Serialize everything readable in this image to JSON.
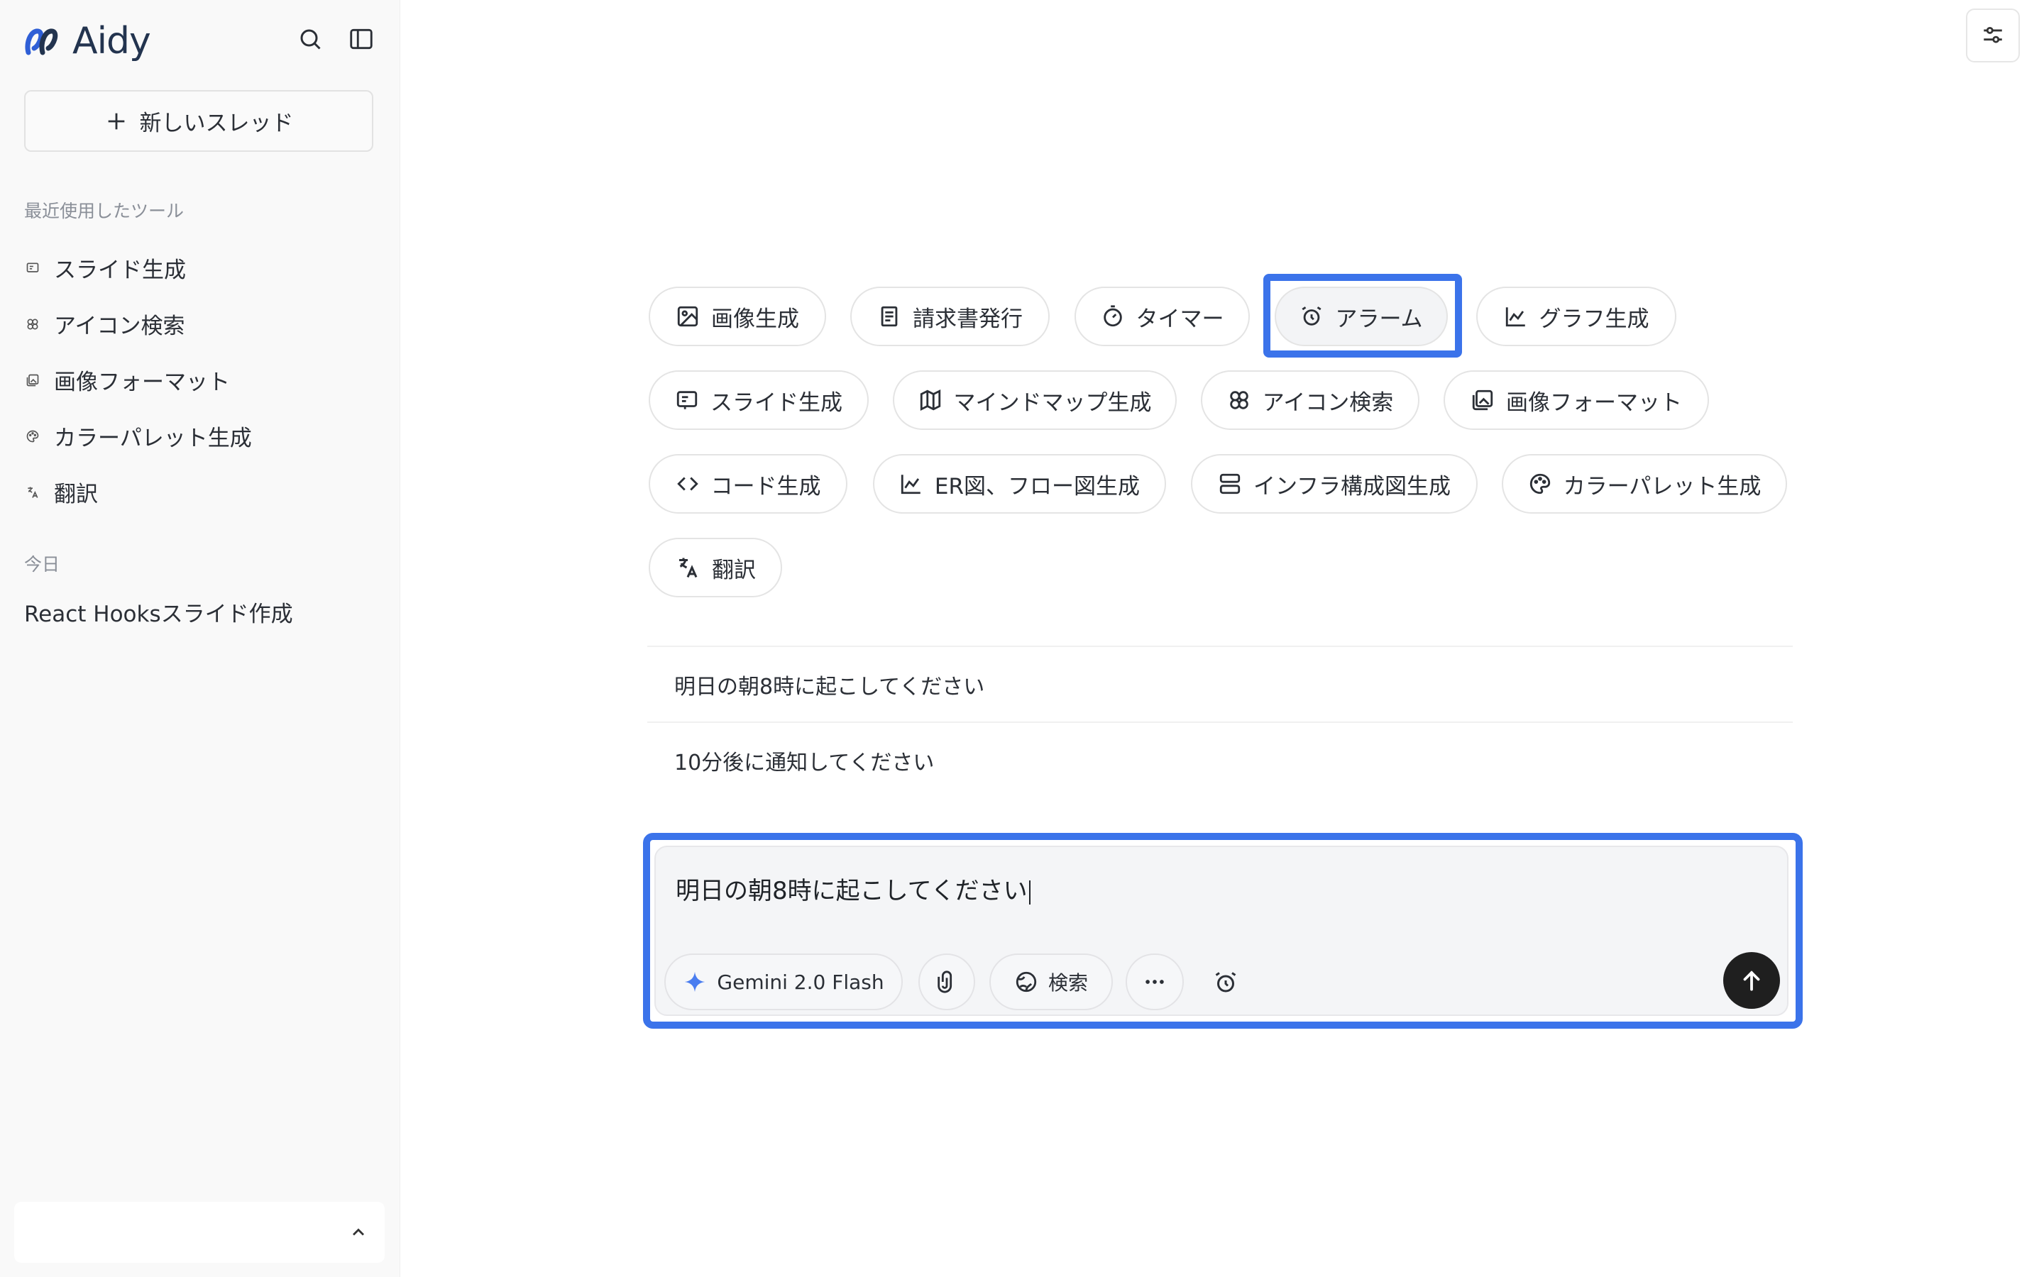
{
  "brand": {
    "name": "Aidy"
  },
  "sidebar": {
    "new_thread_label": "新しいスレッド",
    "recent_label": "最近使用したツール",
    "recent_items": [
      {
        "label": "スライド生成",
        "icon": "slide-icon"
      },
      {
        "label": "アイコン検索",
        "icon": "icon-search-icon"
      },
      {
        "label": "画像フォーマット",
        "icon": "image-format-icon"
      },
      {
        "label": "カラーパレット生成",
        "icon": "palette-icon"
      },
      {
        "label": "翻訳",
        "icon": "translate-icon"
      }
    ],
    "today_label": "今日",
    "history": [
      {
        "label": "React Hooksスライド作成"
      }
    ]
  },
  "tools": {
    "row1": [
      "画像生成",
      "請求書発行",
      "タイマー",
      "アラーム",
      "グラフ生成"
    ],
    "row2": [
      "スライド生成",
      "マインドマップ生成",
      "アイコン検索",
      "画像フォーマット"
    ],
    "row3": [
      "コード生成",
      "ER図、フロー図生成",
      "インフラ構成図生成",
      "カラーパレット生成"
    ],
    "row4": [
      "翻訳"
    ],
    "selected": "アラーム"
  },
  "suggestions": [
    "明日の朝8時に起こしてください",
    "10分後に通知してください"
  ],
  "composer": {
    "value": "明日の朝8時に起こしてください",
    "model_label": "Gemini 2.0 Flash",
    "search_label": "検索"
  },
  "colors": {
    "highlight": "#3b73ea",
    "brand": "#23344f",
    "send": "#1f1f1f"
  }
}
